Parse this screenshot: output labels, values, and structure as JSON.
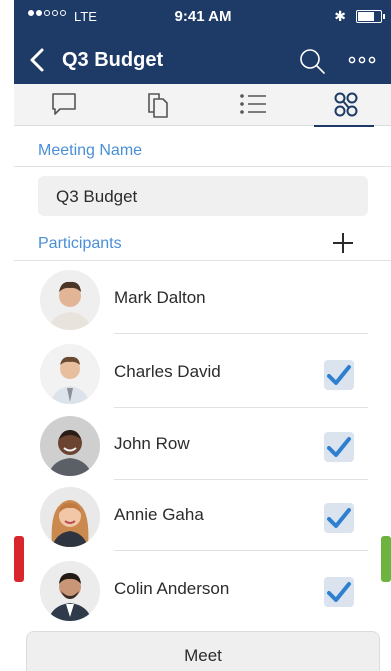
{
  "status_bar": {
    "carrier": "LTE",
    "time": "9:41 AM",
    "bluetooth": "✱"
  },
  "nav": {
    "title": "Q3 Budget",
    "back_icon": "chevron-left-icon",
    "search_icon": "search-icon",
    "more_icon": "more-horizontal-icon"
  },
  "tabs": [
    {
      "icon": "chat-icon",
      "active": false
    },
    {
      "icon": "documents-icon",
      "active": false
    },
    {
      "icon": "list-icon",
      "active": false
    },
    {
      "icon": "people-icon",
      "active": true
    }
  ],
  "meeting": {
    "section_label": "Meeting Name",
    "name_value": "Q3 Budget"
  },
  "participants": {
    "section_label": "Participants",
    "add_icon": "plus-icon",
    "items": [
      {
        "name": "Mark Dalton",
        "checked": false
      },
      {
        "name": "Charles David",
        "checked": true
      },
      {
        "name": "John Row",
        "checked": true
      },
      {
        "name": "Annie Gaha",
        "checked": true
      },
      {
        "name": "Colin Anderson",
        "checked": true
      }
    ]
  },
  "actions": {
    "meet_label": "Meet"
  },
  "colors": {
    "nav_background": "#1e3a66",
    "accent_blue": "#4a8fd6",
    "check_blue": "#2f7fd0",
    "left_handle": "#d9262c",
    "right_handle": "#6cb33f"
  }
}
